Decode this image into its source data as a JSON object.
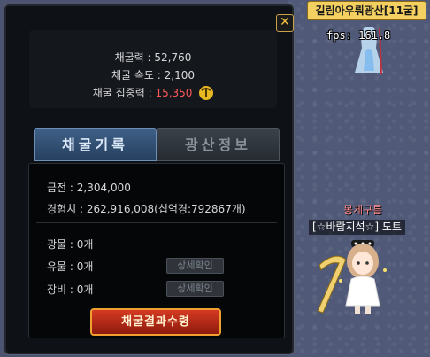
{
  "game": {
    "map_name": "길림아우뤄광산[11굴]",
    "fps_text": "fps: 161.8",
    "character_name": "몽게구름",
    "character_guild": "[☆바람지석☆] 도트"
  },
  "mining_window": {
    "close_label": "✕",
    "stats": {
      "power_label": "채굴력",
      "power_value": "52,760",
      "speed_label": "채굴 속도",
      "speed_value": "2,100",
      "focus_label": "채굴 집중력",
      "focus_value": "15,350",
      "separator": ":"
    },
    "tabs": [
      {
        "label": "채굴기록",
        "active": true
      },
      {
        "label": "광산정보",
        "active": false
      }
    ],
    "record": {
      "gold_label": "금전",
      "gold_value": "2,304,000",
      "exp_label": "경험치",
      "exp_value": "262,916,008(십억경:792867개)",
      "ore_label": "광물",
      "ore_value": "0개",
      "relic_label": "유물",
      "relic_value": "0개",
      "equip_label": "장비",
      "equip_value": "0개",
      "detail_button": "상세확인",
      "collect_button": "채굴결과수령"
    }
  },
  "colors": {
    "accent_gold": "#f0c040",
    "focus_red": "#ff5a5a",
    "collect_button": "#c02a14",
    "active_tab": "#3e5f86"
  }
}
